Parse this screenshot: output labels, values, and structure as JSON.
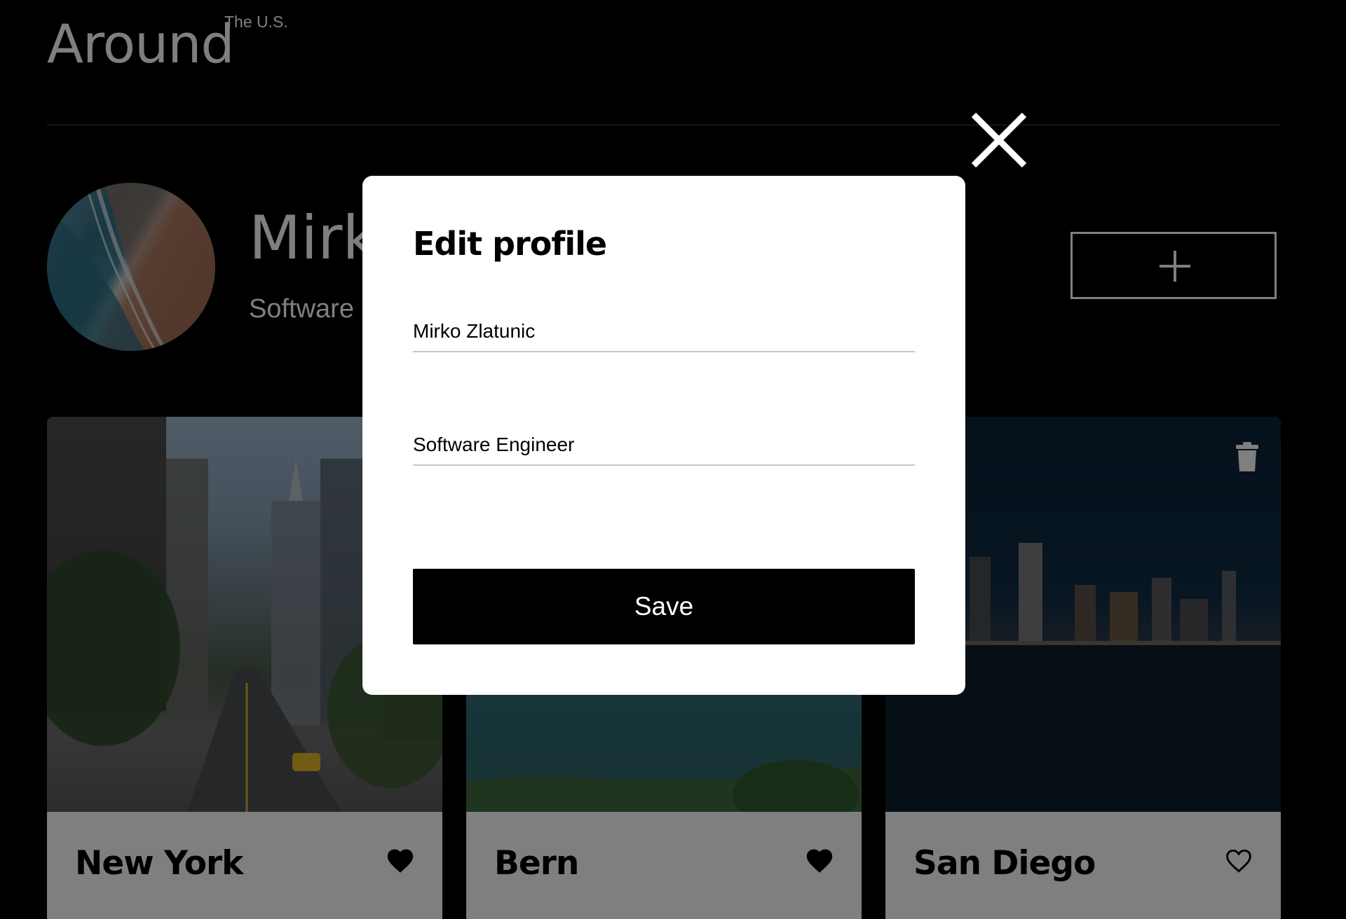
{
  "header": {
    "logo_text": "Around",
    "logo_superscript": "The U.S."
  },
  "profile": {
    "name": "Mirko Zlatunic",
    "about": "Software Engineer",
    "avatar_icon": "avatar-image",
    "add_icon": "plus-icon"
  },
  "cards": [
    {
      "title": "New York",
      "liked": true
    },
    {
      "title": "Bern",
      "liked": true
    },
    {
      "title": "San Diego",
      "liked": false,
      "deletable": true
    }
  ],
  "modal": {
    "title": "Edit profile",
    "name_value": "Mirko Zlatunic",
    "about_value": "Software Engineer",
    "save_label": "Save",
    "close_icon": "close-icon"
  },
  "colors": {
    "background": "#000000",
    "modal_background": "#ffffff",
    "overlay": "rgba(0,0,0,0.5)",
    "input_border": "#c8c8c8"
  }
}
